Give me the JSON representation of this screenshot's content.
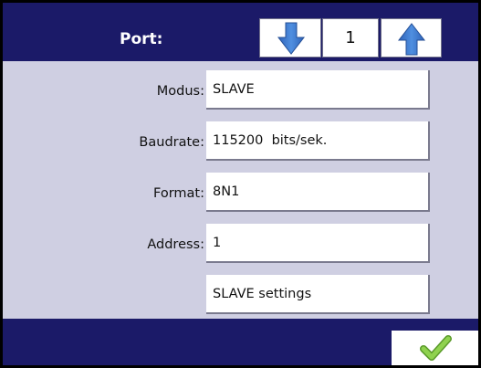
{
  "header": {
    "port_label": "Port:",
    "port_value": "1",
    "down_icon": "arrow-down-icon",
    "up_icon": "arrow-up-icon",
    "color": "#1b1a68"
  },
  "form": {
    "rows": [
      {
        "label": "Modus:",
        "value": "SLAVE"
      },
      {
        "label": "Baudrate:",
        "value": "115200  bits/sek."
      },
      {
        "label": "Format:",
        "value": "8N1"
      },
      {
        "label": "Address:",
        "value": "1"
      }
    ],
    "slave_settings_label": "SLAVE settings"
  },
  "footer": {
    "ok_icon": "checkmark-icon",
    "ok_color": "#7bc043"
  }
}
